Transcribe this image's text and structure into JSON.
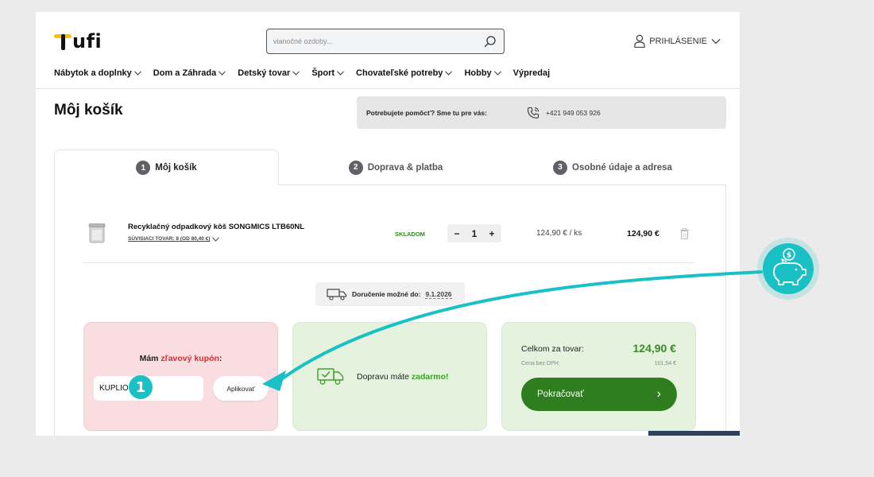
{
  "header": {
    "logo_text": "ufi",
    "search": {
      "placeholder": "vianočné ozdoby..."
    },
    "login_label": "PRIHLÁSENIE"
  },
  "nav": {
    "items": [
      {
        "label": "Nábytok a doplnky",
        "has_dropdown": true
      },
      {
        "label": "Dom a Záhrada",
        "has_dropdown": true
      },
      {
        "label": "Detský tovar",
        "has_dropdown": true
      },
      {
        "label": "Šport",
        "has_dropdown": true
      },
      {
        "label": "Chovateľské potreby",
        "has_dropdown": true
      },
      {
        "label": "Hobby",
        "has_dropdown": true
      },
      {
        "label": "Výpredaj",
        "has_dropdown": false
      }
    ]
  },
  "page": {
    "title": "Môj košík",
    "help_text": "Potrebujete pomôcť? Sme tu pre vás:",
    "help_phone": "+421 949 053 926"
  },
  "steps": [
    {
      "num": "1",
      "label": "Môj košík",
      "active": true
    },
    {
      "num": "2",
      "label": "Doprava & platba",
      "active": false
    },
    {
      "num": "3",
      "label": "Osobné údaje a adresa",
      "active": false
    }
  ],
  "cart": {
    "item": {
      "name": "Recyklačný odpadkový kôš SONGMICS LTB60NL",
      "related": "SÚVISIACI TOVAR: 8 (OD 80,40 €)",
      "stock": "SKLADOM",
      "quantity": "1",
      "qty_minus": "−",
      "qty_plus": "+",
      "unit_price": "124,90 € / ks",
      "total": "124,90 €"
    },
    "delivery": {
      "label": "Doručenie možné do:",
      "date": "9.1.2026"
    }
  },
  "coupon": {
    "title_prefix": "Mám ",
    "title_accent": "zľavový kupón",
    "title_suffix": ":",
    "code_value": "KUPLIO",
    "apply_label": "Aplikovať"
  },
  "shipping": {
    "text_prefix": "Dopravu máte ",
    "text_accent": "zadarmo!"
  },
  "summary": {
    "total_label": "Celkom za tovar:",
    "total_value": "124,90 €",
    "net_label": "Cena bez DPH:",
    "net_value": "101,54 €",
    "continue_label": "Pokračovať",
    "continue_arrow": "›"
  },
  "overlay": {
    "badge_number": "1",
    "accent_color": "#19c1c4"
  },
  "colors": {
    "brand_green": "#2e7d1e",
    "price_green": "#3a8a28",
    "coupon_red": "#e02a2a",
    "logo_yellow": "#f5c400"
  }
}
